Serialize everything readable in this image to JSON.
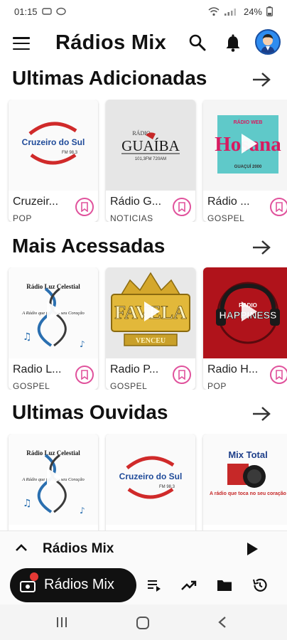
{
  "status_bar": {
    "time": "01:15",
    "battery": "24%"
  },
  "app_bar": {
    "title": "Rádios Mix",
    "avatar_icon": "user-avatar-icon"
  },
  "sections": [
    {
      "title": "Ultimas Adicionadas",
      "cards": [
        {
          "name": "Cruzeir...",
          "genre": "POP",
          "logo_text": "Cruzeiro do Sul",
          "logo_sub": "FM 98,3"
        },
        {
          "name": "Rádio G...",
          "genre": "NOTICIAS",
          "logo_text": "GUAÍBA",
          "logo_sub": "101,3FM   720AM",
          "logo_top": "RÁDIO"
        },
        {
          "name": "Rádio ...",
          "genre": "GOSPEL",
          "logo_text": "Hosana",
          "logo_top": "RÁDIO WEB",
          "logo_sub": "GUAÇUÍ 2000"
        }
      ]
    },
    {
      "title": "Mais Acessadas",
      "cards": [
        {
          "name": "Radio L...",
          "genre": "GOSPEL",
          "logo_text": "A Rádio que toca no seu Coração",
          "logo_top": "Rádio Luz Celestial"
        },
        {
          "name": "Radio P...",
          "genre": "GOSPEL",
          "logo_text": "FAVELA",
          "logo_sub": "VENCEU"
        },
        {
          "name": "Radio H...",
          "genre": "POP",
          "logo_text": "HAPPINESS",
          "logo_top": "RADIO"
        }
      ]
    },
    {
      "title": "Ultimas Ouvidas",
      "cards": [
        {
          "name": "",
          "genre": "",
          "logo_text": "A Rádio que toca no seu Coração",
          "logo_top": "Rádio Luz Celestial"
        },
        {
          "name": "",
          "genre": "",
          "logo_text": "Cruzeiro do Sul",
          "logo_sub": "FM 98,3"
        },
        {
          "name": "",
          "genre": "",
          "logo_text": "Mix Total",
          "logo_sub": "A rádio que toca no seu coração"
        }
      ]
    }
  ],
  "mini_player": {
    "title": "Rádios Mix"
  },
  "bottom_nav": {
    "active_label": "Rádios Mix",
    "items": [
      "queue-icon",
      "trending-icon",
      "folder-icon",
      "history-icon"
    ]
  },
  "colors": {
    "accent_pink": "#e0529c",
    "nav_active_bg": "#111111",
    "badge_red": "#e53935"
  }
}
